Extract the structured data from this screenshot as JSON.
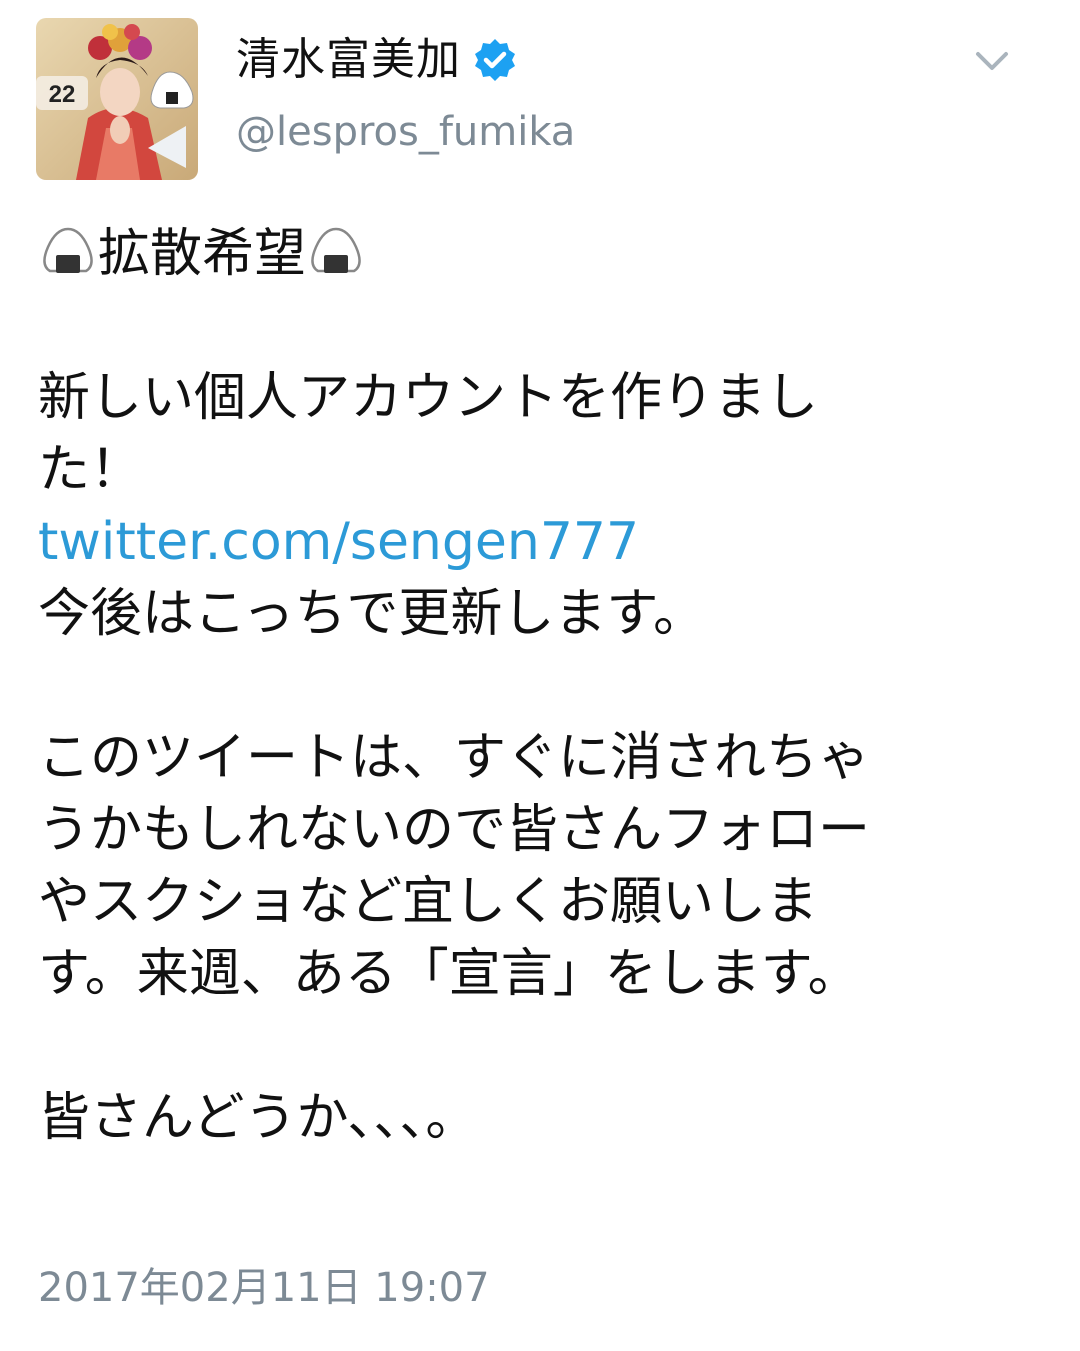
{
  "author": {
    "display_name": "清水富美加",
    "handle": "@lespros_fumika",
    "avatar_badge": "22",
    "verified": true
  },
  "tweet": {
    "hashtag_line": "拡散希望",
    "line1": "新しい個人アカウントを作りまし",
    "line2": "た！",
    "link": "twitter.com/sengen777",
    "line3": "今後はこっちで更新します。",
    "line4": "このツイートは、すぐに消されちゃ",
    "line5": "うかもしれないので皆さんフォロー",
    "line6": "やスクショなど宜しくお願いしま",
    "line7": "す。来週、ある「宣言」をします。",
    "line8": "皆さんどうか、、、。",
    "timestamp": "2017年02月11日 19:07"
  },
  "colors": {
    "link": "#2c9ad7",
    "muted": "#7d8a95",
    "verified_badge": "#1da1f2"
  },
  "icons": {
    "verified": "verified-badge-icon",
    "menu": "chevron-down-icon",
    "emoji": "rice-ball-emoji"
  }
}
